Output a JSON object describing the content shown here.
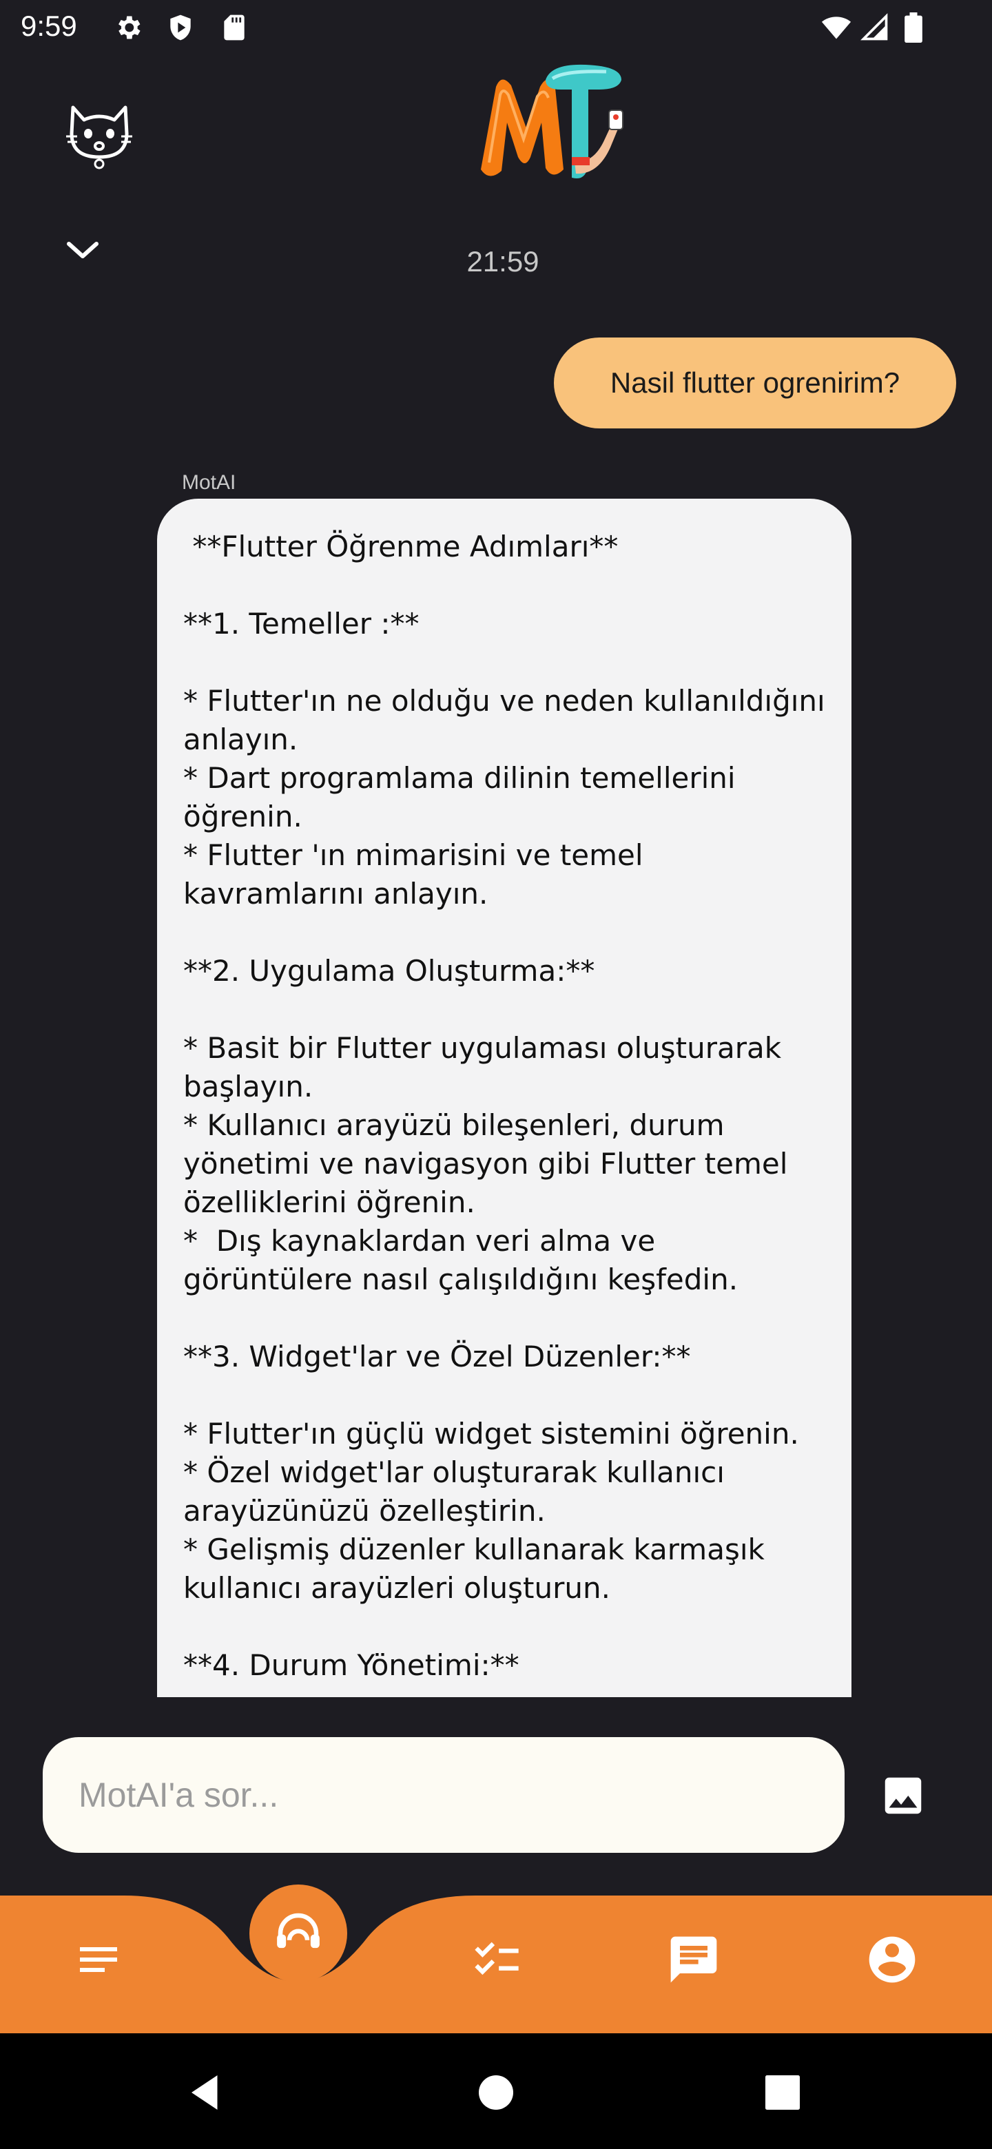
{
  "status_bar": {
    "time": "9:59",
    "icons": [
      "gear-icon",
      "shield-play-icon",
      "sd-card-icon",
      "wifi-icon",
      "signal-icon",
      "battery-icon"
    ]
  },
  "header": {
    "logo_text": "MT"
  },
  "chat": {
    "timestamp": "21:59",
    "user_message": "Nasil flutter ogrenirim?",
    "bot_name": "MotAI",
    "bot_message": " **Flutter Öğrenme Adımları**\n\n**1. Temeller :**\n\n* Flutter'ın ne olduğu ve neden kullanıldığını anlayın.\n* Dart programlama dilinin temellerini öğrenin.\n* Flutter 'ın mimarisini ve temel kavramlarını anlayın.\n\n**2. Uygulama Oluşturma:**\n\n* Basit bir Flutter uygulaması oluşturarak başlayın.\n* Kullanıcı arayüzü bileşenleri, durum yönetimi ve navigasyon gibi Flutter temel özelliklerini öğrenin.\n*  Dış kaynaklardan veri alma ve görüntülere nasıl çalışıldığını keşfedin.\n\n**3. Widget'lar ve Özel Düzenler:**\n\n* Flutter'ın güçlü widget sistemini öğrenin.\n* Özel widget'lar oluşturarak kullanıcı arayüzünüzü özelleştirin.\n* Gelişmiş düzenler kullanarak karmaşık kullanıcı arayüzleri oluşturun.\n\n**4. Durum Yönetimi:**"
  },
  "input": {
    "placeholder": "MotAI'a sor..."
  },
  "bottom_nav": {
    "items": [
      "menu-icon",
      "support-agent-icon",
      "checklist-icon",
      "chat-icon",
      "profile-icon"
    ]
  },
  "colors": {
    "background": "#1d1c22",
    "accent_orange": "#ef8431",
    "user_bubble": "#f9c27b",
    "bot_bubble": "#f3f3f4",
    "input_bg": "#fdfbf3"
  }
}
